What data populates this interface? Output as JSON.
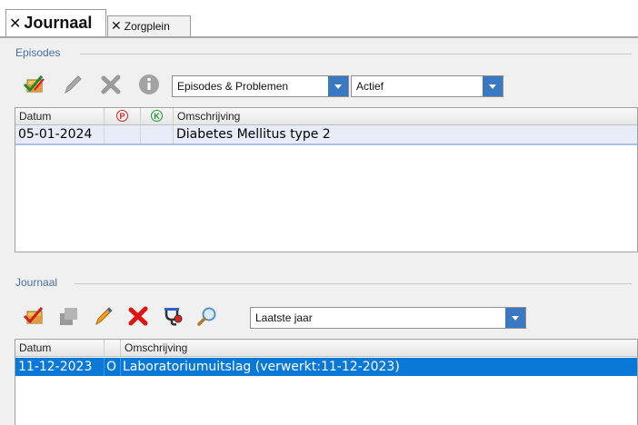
{
  "tabs": [
    {
      "label": "Journaal",
      "close": "✕",
      "active": true
    },
    {
      "label": "Zorgplein",
      "close": "✕",
      "active": false
    }
  ],
  "episodes": {
    "group_title": "Episodes",
    "toolbar": [
      "add-episode-icon",
      "edit-pencil-icon",
      "delete-x-icon",
      "info-icon"
    ],
    "filter1": "Episodes & Problemen",
    "filter2": "Actief",
    "columns": {
      "datum": "Datum",
      "p": "P",
      "k": "K",
      "omschrijving": "Omschrijving"
    },
    "rows": [
      {
        "datum": "05-01-2024",
        "p": "",
        "k": "",
        "omschrijving": "Diabetes Mellitus type 2"
      }
    ]
  },
  "journaal": {
    "group_title": "Journaal",
    "toolbar": [
      "add-entry-icon",
      "copy-icon",
      "edit-pencil-icon",
      "delete-x-icon",
      "stethoscope-icon",
      "search-icon"
    ],
    "filter": "Laatste jaar",
    "columns": {
      "datum": "Datum",
      "type": "",
      "omschrijving": "Omschrijving"
    },
    "rows": [
      {
        "datum": "11-12-2023",
        "type": "O",
        "omschrijving": "Laboratoriumuitslag (verwerkt:11-12-2023)"
      }
    ]
  },
  "colors": {
    "selection": "#0a78d7",
    "accent": "#3a78c2",
    "group_title": "#4a6fa5"
  }
}
